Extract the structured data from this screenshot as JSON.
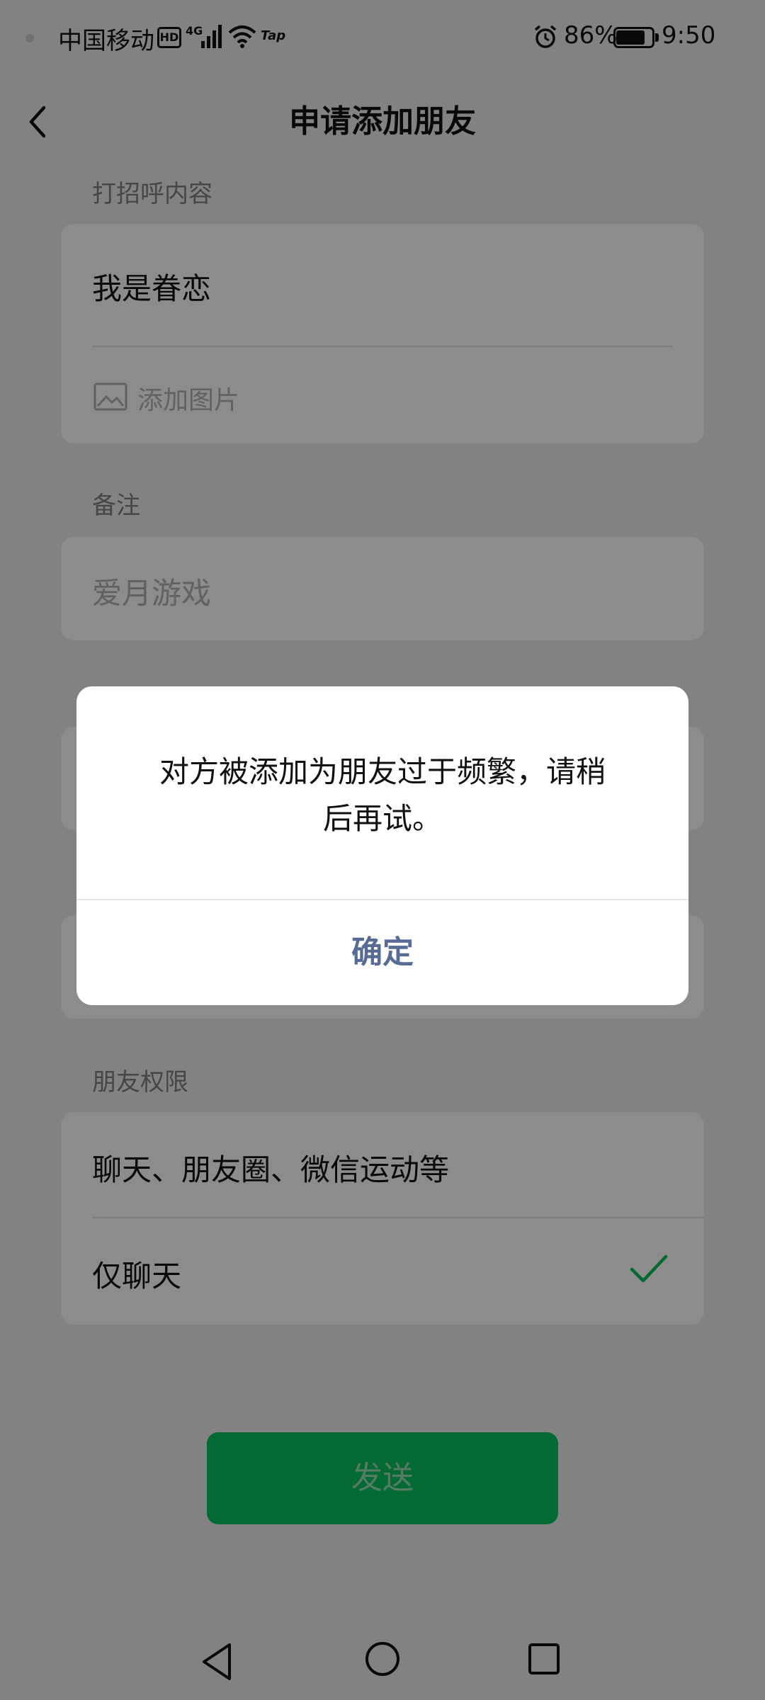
{
  "status_bar": {
    "carrier": "中国移动",
    "hd": "HD",
    "network": "4G",
    "tap": "Tap",
    "battery_percent": "86%",
    "battery_level": 0.86,
    "time": "9:50"
  },
  "header": {
    "title": "申请添加朋友"
  },
  "greeting": {
    "label": "打招呼内容",
    "text": "我是眷恋",
    "add_image": "添加图片"
  },
  "remark": {
    "label": "备注",
    "value": "爱月游戏"
  },
  "permissions": {
    "label": "朋友权限",
    "options": [
      {
        "label": "聊天、朋友圈、微信运动等",
        "selected": false
      },
      {
        "label": "仅聊天",
        "selected": true
      }
    ]
  },
  "send_button": "发送",
  "dialog": {
    "message_line1": "对方被添加为朋友过于频繁，请稍",
    "message_line2": "后再试。",
    "confirm": "确定"
  },
  "colors": {
    "primary_green": "#07c160",
    "link_blue": "#576b95",
    "mask": "rgba(0,0,0,0.45)"
  }
}
